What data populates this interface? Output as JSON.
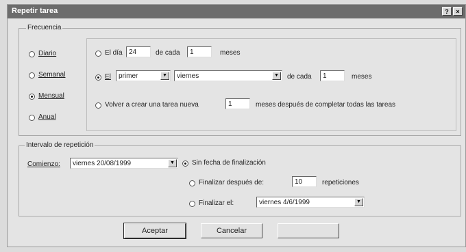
{
  "window": {
    "title": "Repetir tarea",
    "help_glyph": "?",
    "close_glyph": "×"
  },
  "frequency": {
    "group_label": "Frecuencia",
    "options": [
      "Diario",
      "Semanal",
      "Mensual",
      "Anual"
    ],
    "selected": "Mensual"
  },
  "monthly": {
    "day_label": "El día",
    "day_value": "24",
    "every_label": "de cada",
    "every_months_value": "1",
    "months_label": "meses",
    "the_label": "El",
    "ordinal_value": "primer",
    "weekday_value": "viernes",
    "every_label2": "de cada",
    "every_months_value2": "1",
    "months_label2": "meses",
    "regenerate_label": "Volver a crear una tarea nueva",
    "regenerate_value": "1",
    "regenerate_suffix": "meses después de completar todas las tareas"
  },
  "range": {
    "group_label": "Intervalo de repetición",
    "start_label": "Comienzo:",
    "start_value": "viernes 20/08/1999",
    "no_end_label": "Sin fecha de finalización",
    "end_after_label": "Finalizar después de:",
    "end_after_value": "10",
    "occurrences_label": "repeticiones",
    "end_by_label": "Finalizar el:",
    "end_by_value": "viernes 4/6/1999",
    "selected": "no_end"
  },
  "buttons": {
    "ok": "Aceptar",
    "cancel": "Cancelar",
    "remove": ""
  },
  "icons": {
    "dropdown": "▼"
  }
}
